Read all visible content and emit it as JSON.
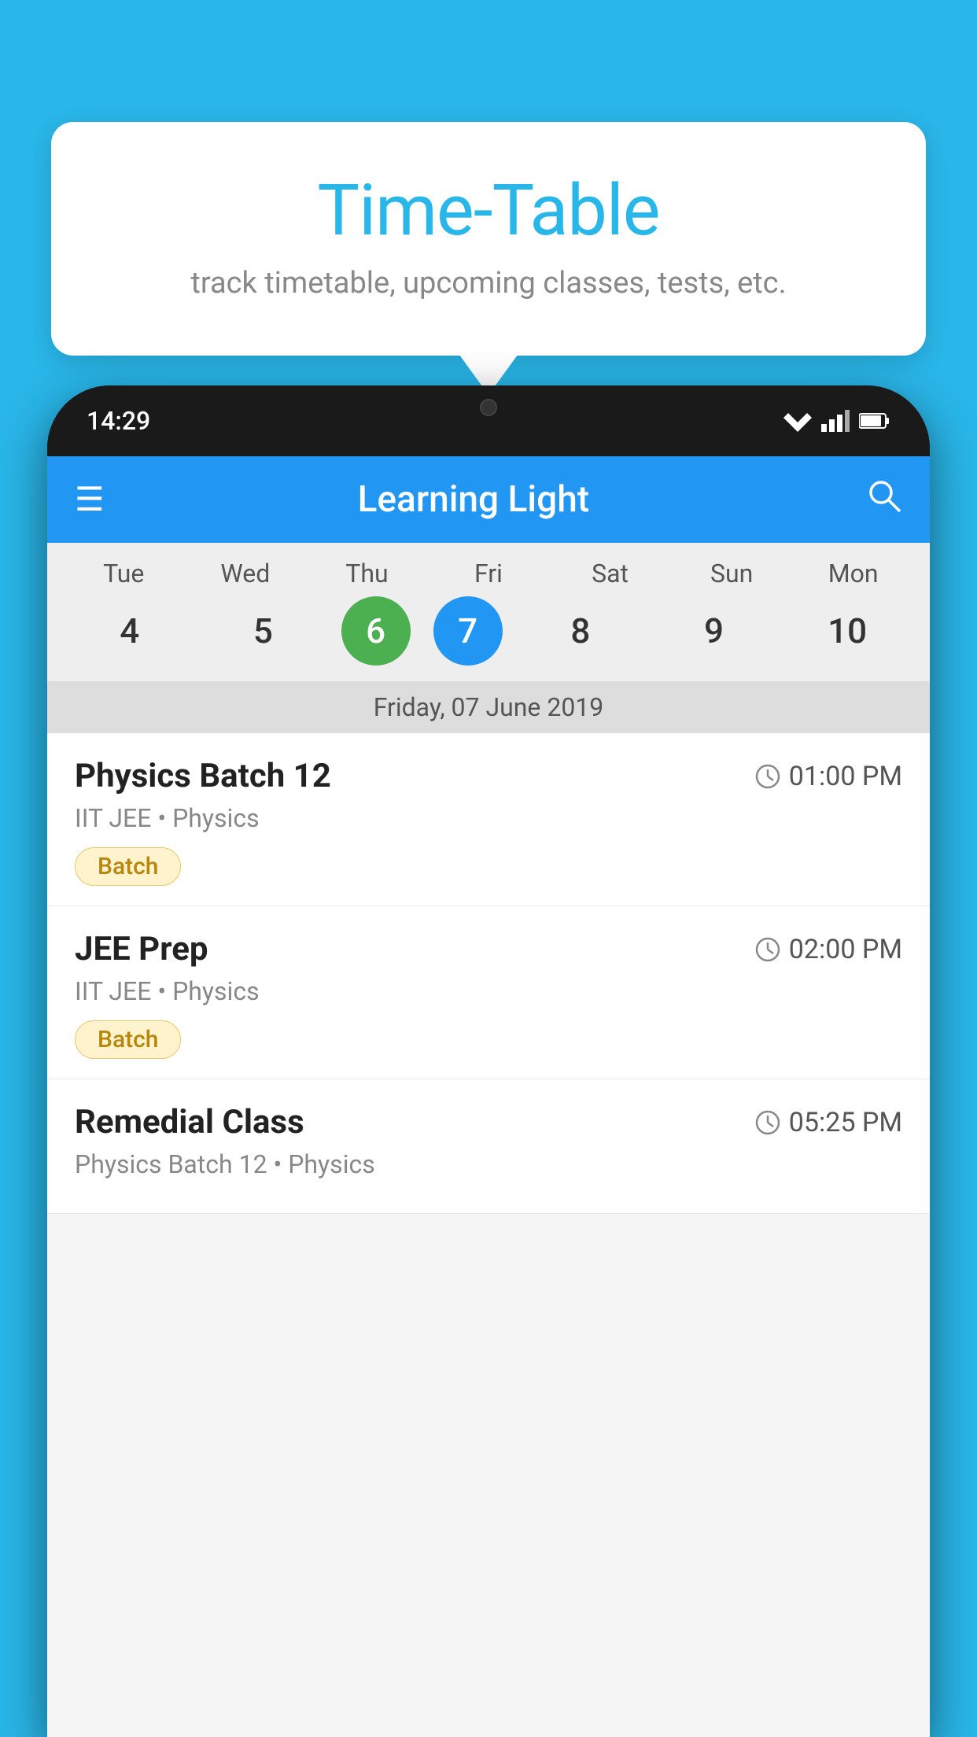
{
  "background_color": "#29b6e8",
  "tooltip": {
    "title": "Time-Table",
    "subtitle": "track timetable, upcoming classes, tests, etc."
  },
  "phone": {
    "status_bar": {
      "time": "14:29",
      "wifi": "▼",
      "signal": "▲",
      "battery": "▌"
    },
    "app_header": {
      "title": "Learning Light",
      "hamburger_label": "☰",
      "search_label": "🔍"
    },
    "calendar": {
      "days": [
        {
          "label": "Tue",
          "number": "4",
          "state": "normal"
        },
        {
          "label": "Wed",
          "number": "5",
          "state": "normal"
        },
        {
          "label": "Thu",
          "number": "6",
          "state": "today"
        },
        {
          "label": "Fri",
          "number": "7",
          "state": "selected"
        },
        {
          "label": "Sat",
          "number": "8",
          "state": "normal"
        },
        {
          "label": "Sun",
          "number": "9",
          "state": "normal"
        },
        {
          "label": "Mon",
          "number": "10",
          "state": "normal"
        }
      ],
      "selected_date_label": "Friday, 07 June 2019"
    },
    "classes": [
      {
        "name": "Physics Batch 12",
        "time": "01:00 PM",
        "meta": "IIT JEE • Physics",
        "badge": "Batch"
      },
      {
        "name": "JEE Prep",
        "time": "02:00 PM",
        "meta": "IIT JEE • Physics",
        "badge": "Batch"
      },
      {
        "name": "Remedial Class",
        "time": "05:25 PM",
        "meta": "Physics Batch 12 • Physics",
        "badge": ""
      }
    ]
  }
}
